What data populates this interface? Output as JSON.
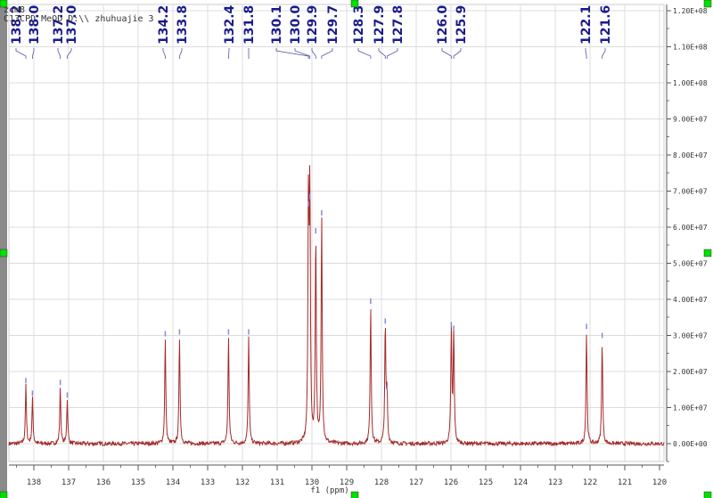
{
  "header": {
    "line1": "zcm8",
    "line2": "C13CPD MeOD D:\\\\ zhuhuajie 3"
  },
  "colors": {
    "spectrum": "#a52a2a",
    "peak_label": "#1a1a8c",
    "grid": "#d8d8d8",
    "handle": "#00e000"
  },
  "chart_data": {
    "type": "line",
    "title": "",
    "xlabel": "f1 (ppm)",
    "ylabel": "",
    "xlim": [
      138.7,
      119.9
    ],
    "ylim": [
      -3000000.0,
      121000000.0
    ],
    "x_reversed": true,
    "grid": true,
    "x_ticks": [
      "138",
      "137",
      "136",
      "135",
      "134",
      "133",
      "132",
      "131",
      "130",
      "129",
      "128",
      "127",
      "126",
      "125",
      "124",
      "123",
      "122",
      "121",
      "120"
    ],
    "y_ticks": [
      "0.00E+00",
      "1.00E+07",
      "2.00E+07",
      "3.00E+07",
      "4.00E+07",
      "5.00E+07",
      "6.00E+07",
      "7.00E+07",
      "8.00E+07",
      "9.00E+07",
      "1.00E+08",
      "1.10E+08",
      "1.20E+08"
    ],
    "peaks": [
      {
        "label": "138.2",
        "ppm": 138.23,
        "intensity": 16000000.0
      },
      {
        "label": "138.0",
        "ppm": 138.04,
        "intensity": 12500000.0
      },
      {
        "label": "137.2",
        "ppm": 137.24,
        "intensity": 15500000.0
      },
      {
        "label": "137.0",
        "ppm": 137.04,
        "intensity": 12000000.0
      },
      {
        "label": "134.2",
        "ppm": 134.22,
        "intensity": 29000000.0
      },
      {
        "label": "133.8",
        "ppm": 133.81,
        "intensity": 29500000.0
      },
      {
        "label": "132.4",
        "ppm": 132.4,
        "intensity": 29500000.0
      },
      {
        "label": "131.8",
        "ppm": 131.82,
        "intensity": 29500000.0
      },
      {
        "label": "130.1",
        "ppm": 130.1,
        "intensity": 65000000.0
      },
      {
        "label": "130.0",
        "ppm": 130.06,
        "intensity": 67000000.0
      },
      {
        "label": "129.9",
        "ppm": 129.89,
        "intensity": 57500000.0
      },
      {
        "label": "129.7",
        "ppm": 129.72,
        "intensity": 62500000.0
      },
      {
        "label": "128.3",
        "ppm": 128.31,
        "intensity": 38000000.0
      },
      {
        "label": "127.9",
        "ppm": 127.89,
        "intensity": 32500000.0
      },
      {
        "label": "127.8",
        "ppm": 127.84,
        "intensity": 14000000.0
      },
      {
        "label": "126.0",
        "ppm": 125.99,
        "intensity": 31500000.0
      },
      {
        "label": "125.9",
        "ppm": 125.92,
        "intensity": 30500000.0
      },
      {
        "label": "122.1",
        "ppm": 122.1,
        "intensity": 31000000.0
      },
      {
        "label": "121.6",
        "ppm": 121.65,
        "intensity": 28500000.0
      }
    ]
  }
}
